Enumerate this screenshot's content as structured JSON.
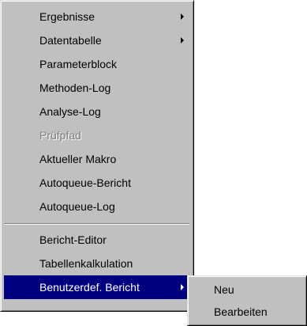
{
  "menu": {
    "items": [
      {
        "label": "Ergebnisse",
        "submenu": true
      },
      {
        "label": "Datentabelle",
        "submenu": true
      },
      {
        "label": "Parameterblock"
      },
      {
        "label": "Methoden-Log"
      },
      {
        "label": "Analyse-Log"
      },
      {
        "label": "Prüfpfad",
        "disabled": true
      },
      {
        "label": "Aktueller Makro"
      },
      {
        "label": "Autoqueue-Bericht"
      },
      {
        "label": "Autoqueue-Log"
      },
      {
        "label": "Bericht-Editor"
      },
      {
        "label": "Tabellenkalkulation"
      },
      {
        "label": "Benutzerdef. Bericht",
        "submenu": true,
        "selected": true
      }
    ]
  },
  "submenu": {
    "items": [
      {
        "label": "Neu"
      },
      {
        "label": "Bearbeiten"
      }
    ]
  },
  "colors": {
    "menu_face": "#c0c0c0",
    "highlight": "#000080",
    "highlight_text": "#ffffff",
    "disabled_text": "#808080"
  }
}
